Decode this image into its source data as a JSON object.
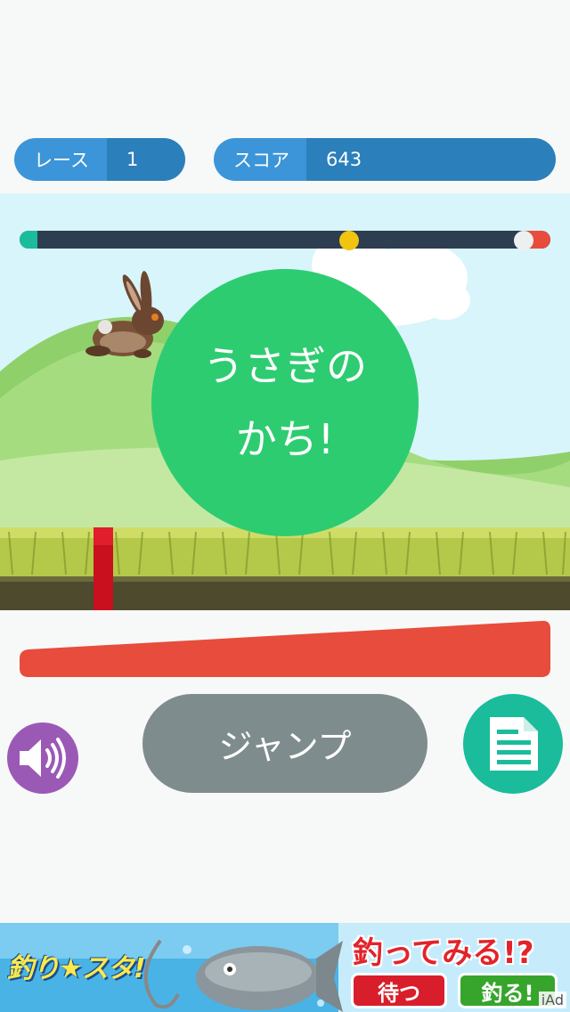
{
  "hud": {
    "race_label": "レース",
    "race_value": "1",
    "score_label": "スコア",
    "score_value": "643"
  },
  "progress": {
    "rabbit_position_fraction": 0.62,
    "turtle_position_fraction": 0.95
  },
  "result": {
    "message": "うさぎの\nかち!"
  },
  "controls": {
    "jump_label": "ジャンプ",
    "sound_icon": "speaker-icon",
    "doc_icon": "document-icon"
  },
  "ad": {
    "brand": "釣り★スタ!",
    "headline": "釣ってみる!?",
    "wait_button": "待つ",
    "fish_button": "釣る!",
    "iad_label": "iAd"
  },
  "colors": {
    "win_circle": "#2ecc71",
    "power_bar": "#e74c3c",
    "sound_button": "#9b59b6",
    "doc_button": "#1abc9c",
    "jump_button": "#7f8c8d"
  }
}
